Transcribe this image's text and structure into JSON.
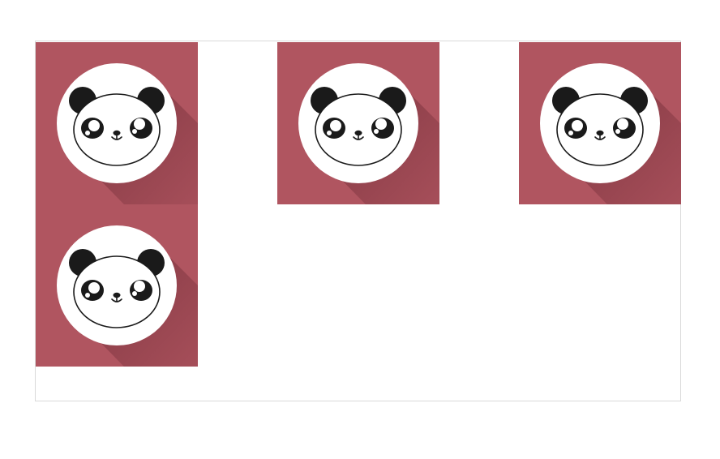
{
  "theme": {
    "tile_color": "#b05560",
    "circle_color": "#ffffff",
    "ink_color": "#1a1a1a",
    "shadow_color": "#5a1e28",
    "border_color": "#d9d9d9"
  },
  "tiles": [
    {
      "icon": "panda-face-icon",
      "tile_color": "#b05560"
    },
    {
      "icon": "panda-face-icon",
      "tile_color": "#b05560"
    },
    {
      "icon": "panda-face-icon",
      "tile_color": "#b05560"
    },
    {
      "icon": "panda-face-icon",
      "tile_color": "#b05560"
    }
  ]
}
